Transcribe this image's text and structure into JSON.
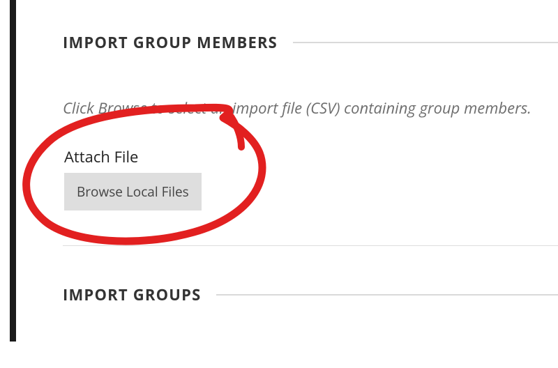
{
  "sections": {
    "import_members": {
      "title": "IMPORT GROUP MEMBERS",
      "instruction": "Click Browse to select an import file (CSV) containing group members.",
      "attach_label": "Attach File",
      "browse_button": "Browse Local Files"
    },
    "import_groups": {
      "title": "IMPORT GROUPS"
    }
  },
  "annotation": {
    "type": "hand-drawn-circle",
    "color": "#e22020"
  }
}
